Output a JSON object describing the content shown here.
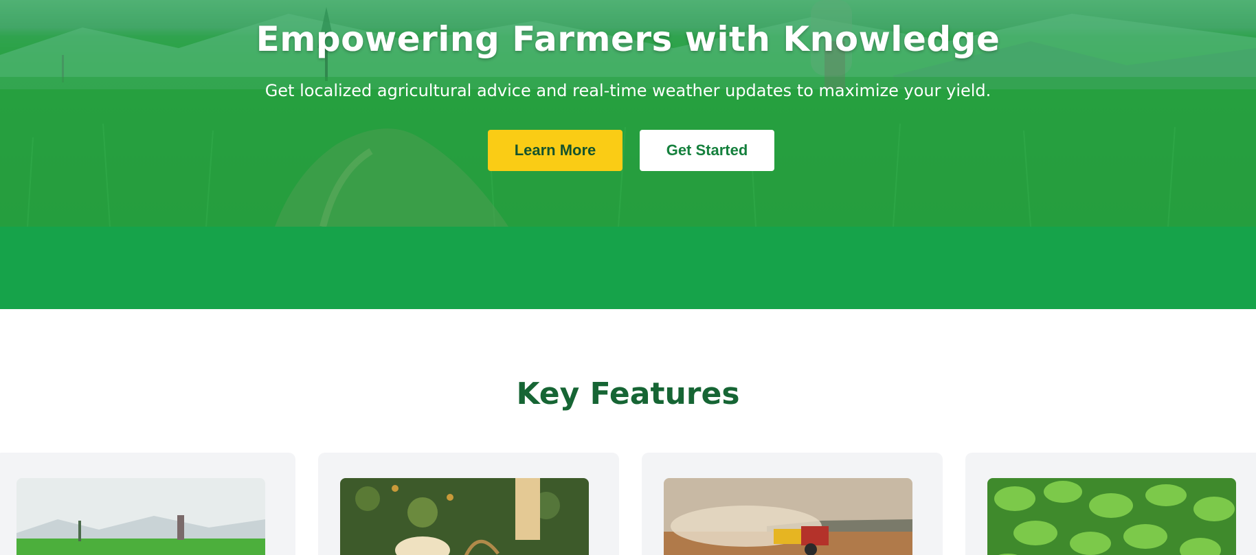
{
  "hero": {
    "title": "Empowering Farmers with Knowledge",
    "subtitle": "Get localized agricultural advice and real-time weather updates to maximize your yield.",
    "learn_more_label": "Learn More",
    "get_started_label": "Get Started"
  },
  "features": {
    "title": "Key Features"
  },
  "colors": {
    "brand_green": "#16a34a",
    "accent_yellow": "#facc15",
    "heading_green": "#166534"
  }
}
